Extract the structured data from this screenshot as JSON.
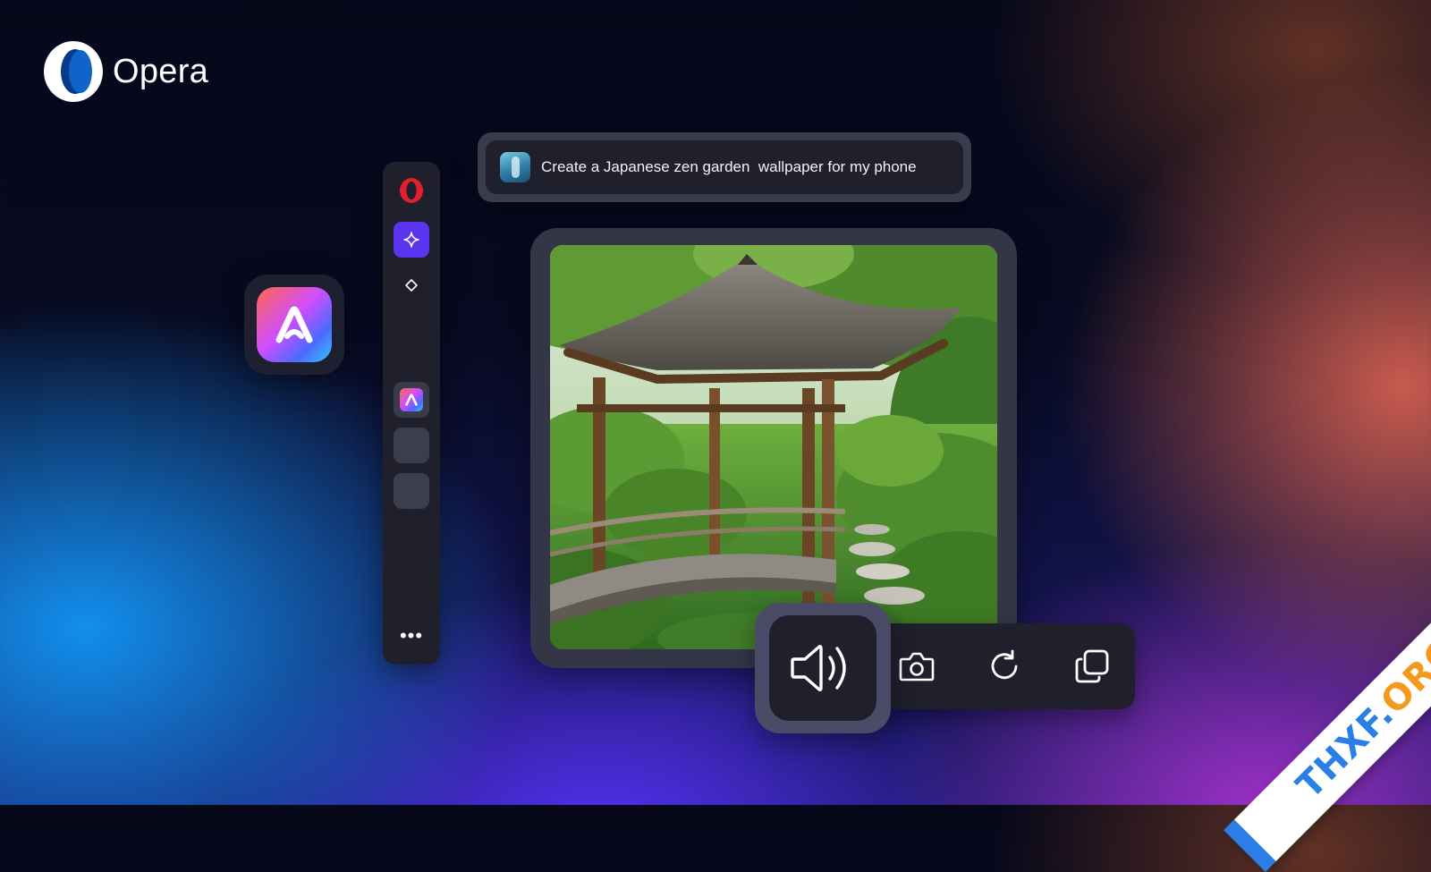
{
  "brand": {
    "name": "Opera"
  },
  "sidebar": {
    "items": [
      {
        "name": "opera-icon"
      },
      {
        "name": "aria-sparkle-icon"
      },
      {
        "name": "diamond-icon"
      },
      {
        "name": "aria-app-icon"
      },
      {
        "name": "blank-slot"
      },
      {
        "name": "blank-slot"
      }
    ],
    "more_label": "•••"
  },
  "prompt": {
    "text": "Create a Japanese zen garden  wallpaper for my phone"
  },
  "toolbar": {
    "actions": [
      "speaker-icon",
      "camera-icon",
      "refresh-icon",
      "copy-icon"
    ]
  },
  "watermark": {
    "main": "THXF.",
    "accent": "ORG"
  },
  "colors": {
    "aria_accent": "#5b35f0",
    "panel": "#1f202c",
    "opera_red": "#e0202c",
    "watermark_blue": "#2a7fe6",
    "watermark_orange": "#f39a1e"
  }
}
